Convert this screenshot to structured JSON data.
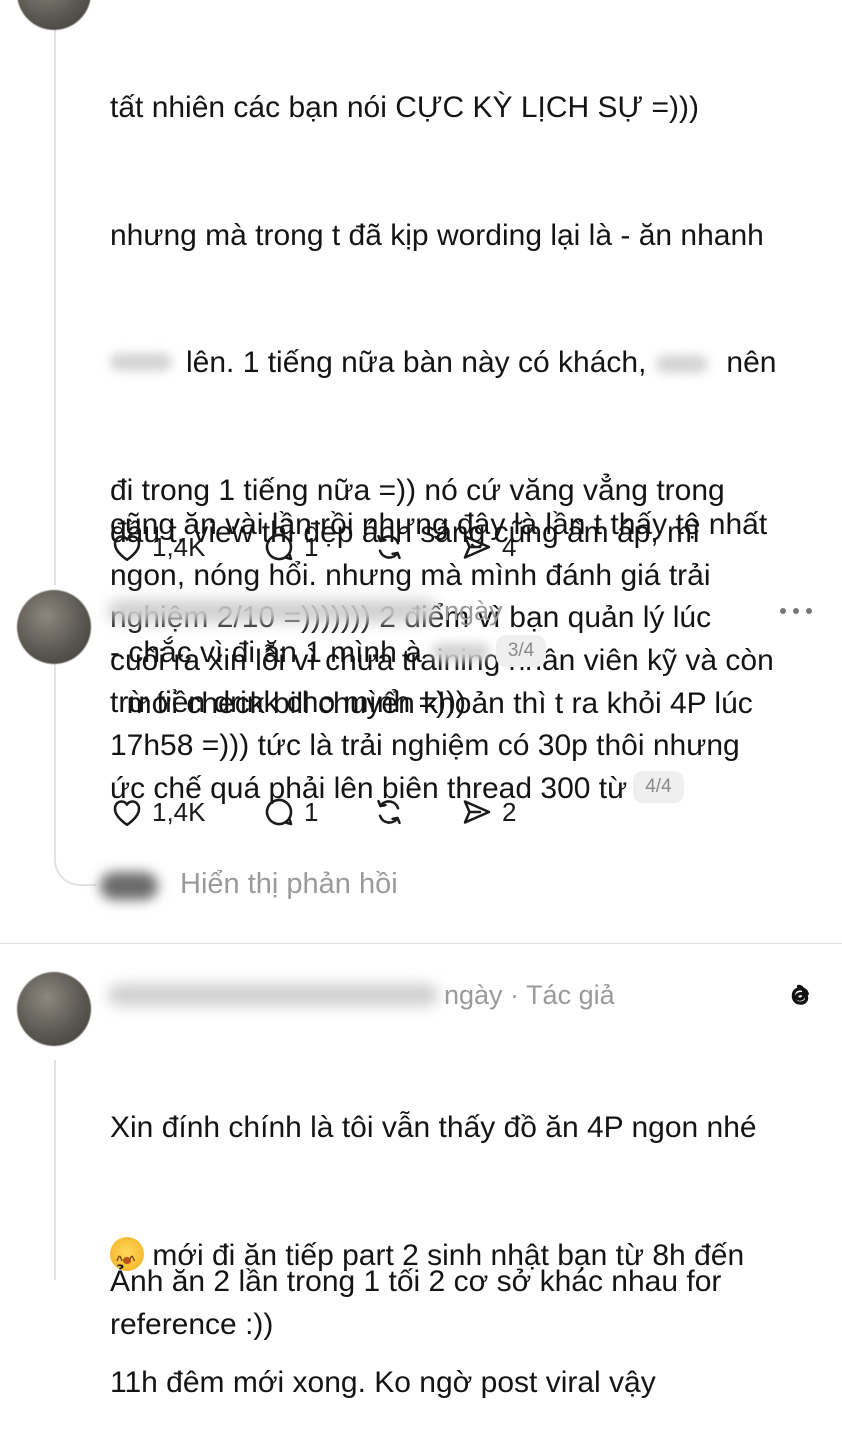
{
  "post1": {
    "para1_line1": "tất nhiên các bạn nói CỰC KỲ LỊCH SỰ =)))",
    "para1_line2": "nhưng mà trong t đã kịp wording lại là - ăn nhanh",
    "para1_line3a": "lên. 1 tiếng nữa bàn này có khách,",
    "para1_line3b": "nên",
    "para1_rest": "đi trong 1 tiếng nữa =)) nó cứ văng vẳng trong\nđầu t. view thì đẹp ánh sáng cũng ấm áp, mì\nngon, nóng hổi. nhưng mà mình đánh giá trải\nnghiệm 2/10 =))))))) 2 điểm vì bạn quản lý lúc\ncuối ra xin lỗi vì chưa training nhân viên kỹ và còn\ntrừ tiền drink cho mình =)))",
    "para2_line1": "cũng ăn vài lần rồi nhưng đây là lần t thấy tệ nhất",
    "para2_line2": "- chắc vì đi ăn 1 mình à",
    "pager": "3/4",
    "likes": "1,4K",
    "replies": "1",
    "shares": "4"
  },
  "post2": {
    "time_suffix": "ngày",
    "body": "mới check bill chuyển khoản thì t ra khỏi 4P lúc\n17h58 =))) tức là trải nghiệm có 30p thôi nhưng\nức chế quá phải lên biên thread 300 từ",
    "pager": "4/4",
    "likes": "1,4K",
    "replies": "1",
    "shares": "2",
    "show_replies": "Hiển thị phản hồi"
  },
  "post3": {
    "time_suffix": "ngày · Tác giả",
    "line1": "Xin đính chính là tôi vẫn thấy đồ ăn 4P ngon nhé",
    "line2": " mới đi ăn tiếp part 2 sinh nhật bạn từ 8h đến",
    "line3": "11h đêm mới xong. Ko ngờ post viral vậy",
    "para2": "Ảnh ăn 2 lần trong 1 tối 2 cơ sở khác nhau for\nreference :))"
  },
  "icons": {
    "like": "heart-icon",
    "reply": "comment-icon",
    "repost": "repost-icon",
    "share": "send-icon",
    "more": "more-icon",
    "brand": "threads-logo-icon"
  }
}
